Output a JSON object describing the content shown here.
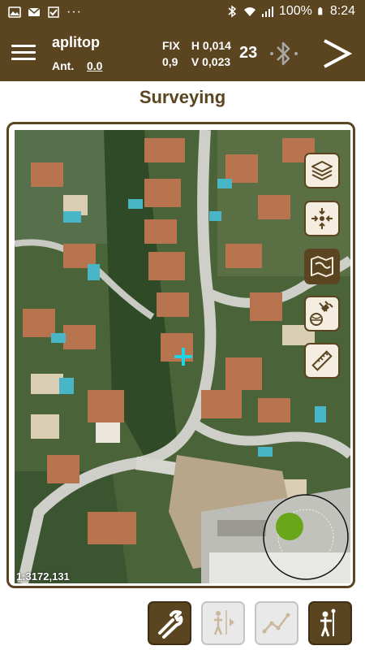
{
  "status_bar": {
    "battery": "100%",
    "time": "8:24",
    "more": "···"
  },
  "toolbar": {
    "app_name": "aplitop",
    "ant_label": "Ant.",
    "ant_value": "0.0",
    "gps": {
      "fix_label": "FIX",
      "h_label": "H",
      "h_value": "0,014",
      "pdop": "0,9",
      "v_label": "V",
      "v_value": "0,023"
    },
    "satellites": "23"
  },
  "page": {
    "title": "Surveying"
  },
  "map": {
    "scale": "1:3172,131",
    "tools": [
      {
        "name": "layers",
        "active": false
      },
      {
        "name": "center-position",
        "active": false
      },
      {
        "name": "map-type",
        "active": true
      },
      {
        "name": "satellite-globe",
        "active": false
      },
      {
        "name": "ruler",
        "active": false
      }
    ]
  },
  "colors": {
    "brand_brown": "#5b4520",
    "button_bg": "#f4ede0",
    "crosshair": "#22d3e6",
    "joystick_green": "#6aa61a"
  },
  "bottom_tools": [
    {
      "name": "settings-wrench",
      "enabled": true
    },
    {
      "name": "stakeout-point",
      "enabled": false
    },
    {
      "name": "stakeout-line",
      "enabled": false
    },
    {
      "name": "survey-point",
      "enabled": true
    }
  ]
}
